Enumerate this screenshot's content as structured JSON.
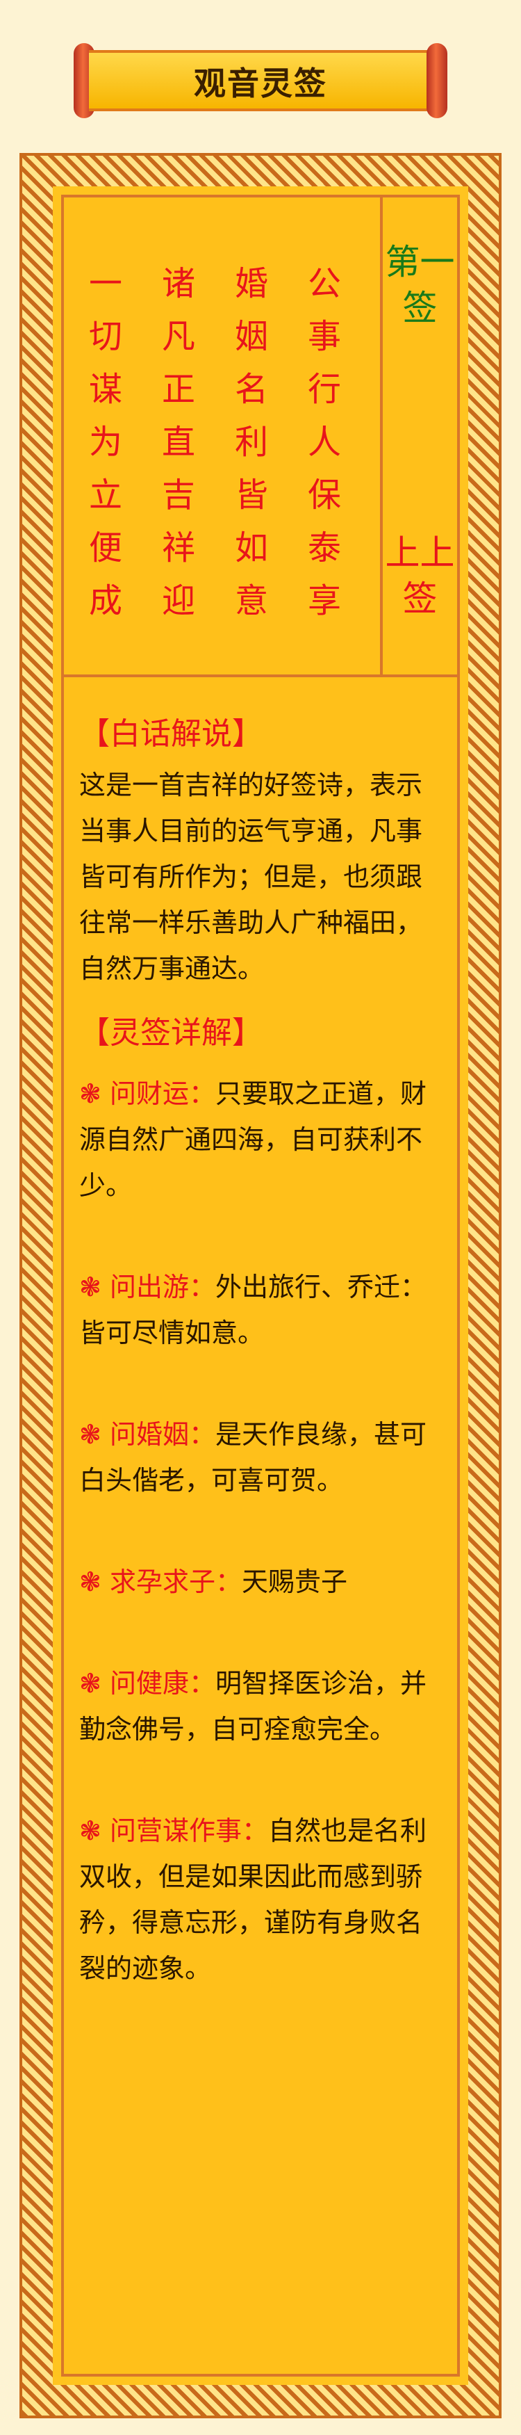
{
  "title": "观音灵签",
  "sign": {
    "number_label": "第一签",
    "grade_label": "上上签"
  },
  "poem": {
    "columns": [
      "公事行人保泰享",
      "婚姻名利皆如意",
      "诸凡正直吉祥迎",
      "一切谋为立便成"
    ]
  },
  "explanation": {
    "heading": "【白话解说】",
    "text": "这是一首吉祥的好签诗，表示当事人目前的运气亨通，凡事皆可有所作为；但是，也须跟往常一样乐善助人广种福田，自然万事通达。"
  },
  "details": {
    "heading": "【灵签详解】",
    "bullet_symbol": "❃",
    "items": [
      {
        "label": "问财运：",
        "text": "只要取之正道，财源自然广通四海，自可获利不少。"
      },
      {
        "label": "问出游：",
        "text": "外出旅行、乔迁：皆可尽情如意。"
      },
      {
        "label": "问婚姻：",
        "text": "是天作良缘，甚可白头偕老，可喜可贺。"
      },
      {
        "label": "求孕求子：",
        "text": "天赐贵子"
      },
      {
        "label": "问健康：",
        "text": "明智择医诊治，并勤念佛号，自可痊愈完全。"
      },
      {
        "label": "问营谋作事：",
        "text": "自然也是名利双收，但是如果因此而感到骄矜，得意忘形，谨防有身败名裂的迹象。"
      }
    ]
  }
}
